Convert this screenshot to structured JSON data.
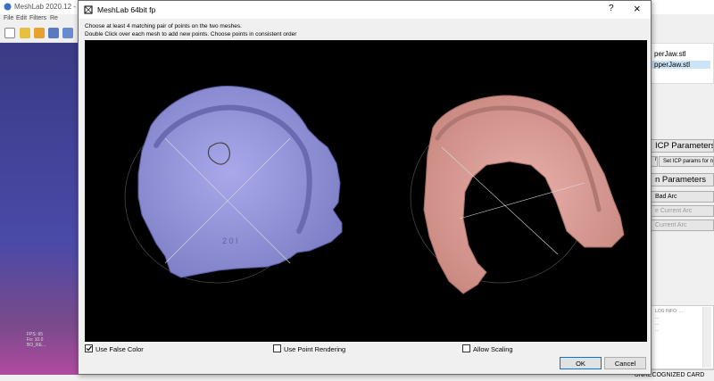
{
  "background_app": {
    "title": "MeshLab 2020.12 - [P",
    "menu": [
      "File",
      "Edit",
      "Filters",
      "Re"
    ],
    "viewport_info": [
      "FPS: 65",
      "Fo: 10.0",
      "BO_RE..."
    ],
    "layers": [
      "perJaw.stl",
      "pperJaw.stl"
    ],
    "buttons": {
      "icp_parameters": "ICP Parameters...",
      "default_icp": "n",
      "set_icp_params": "Set ICP params for n",
      "align_parameters": "n Parameters",
      "bad_arc": "Bad Arc",
      "current_arc": "e Current Arc",
      "current_arc2": "Current Arc"
    },
    "log_lines": [
      "LOG INFO: ...",
      "...",
      "...",
      "..."
    ],
    "status": "UNRECOGNIZED CARD"
  },
  "dialog": {
    "title": "MeshLab 64bit fp",
    "help": "?",
    "close": "×",
    "instruction_line1": "Choose at least 4 matching pair of points on the two meshes.",
    "instruction_line2": "Double Click over each mesh to add new points. Choose points in consistent order",
    "checkboxes": {
      "false_color": {
        "label": "Use False Color",
        "checked": true
      },
      "point_rendering": {
        "label": "Use Point Rendering",
        "checked": false
      },
      "allow_scaling": {
        "label": "Allow Scaling",
        "checked": false
      }
    },
    "ok_label": "OK",
    "cancel_label": "Cancel",
    "mesh_label": "2 0 I"
  },
  "colors": {
    "left_mesh": "#9b9be0",
    "right_mesh": "#dfa09a",
    "viewport_bg": "#000000",
    "ok_border": "#0078d7"
  }
}
